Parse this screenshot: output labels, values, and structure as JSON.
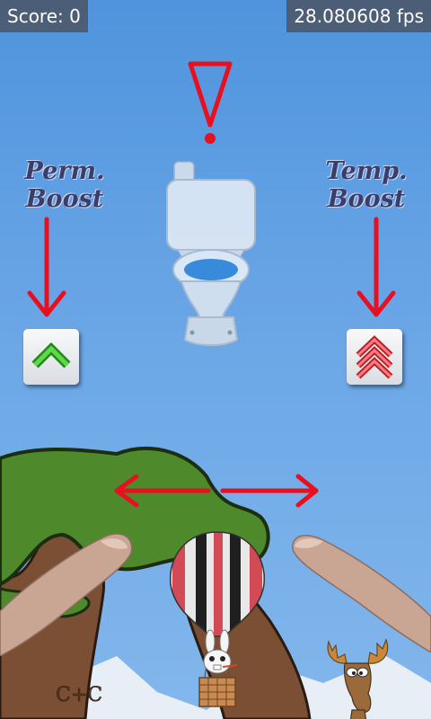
{
  "hud": {
    "score": "Score: 0",
    "fps": "28.080608 fps"
  },
  "tutorial": {
    "perm_boost_label": "Perm.\nBoost",
    "temp_boost_label": "Temp.\nBoost"
  },
  "icons": {
    "warning": "exclamation-triangle-icon",
    "perm_boost": "green-chevron-up-icon",
    "temp_boost": "red-triple-chevron-up-icon"
  },
  "colors": {
    "sky": "#5a9ce2",
    "arrow": "#e8101e",
    "tree_leaves": "#4e8a2c",
    "label": "#3b3d6a"
  }
}
